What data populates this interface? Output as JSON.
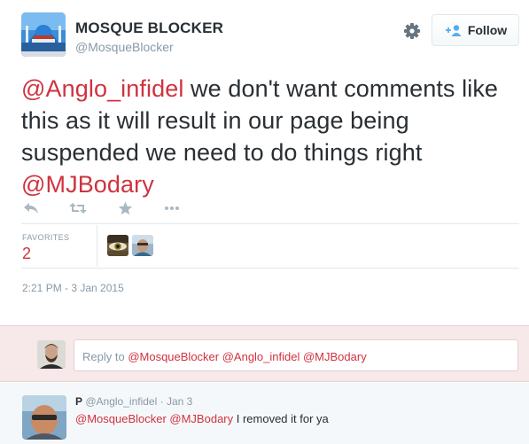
{
  "tweet": {
    "display_name": "MOSQUE BLOCKER",
    "screen_name": "@MosqueBlocker",
    "follow_label": "Follow",
    "text_parts": {
      "mention1": "@Anglo_infidel",
      "body": " we don't want comments like this as it will result in our page being suspended we need to do things right ",
      "mention2": "@MJBodary"
    },
    "actions": [
      "reply-icon",
      "retweet-icon",
      "favorite-icon",
      "more-icon"
    ],
    "stats": {
      "favorites_label": "FAVORITES",
      "favorites_count": "2"
    },
    "timestamp": "2:21 PM - 3 Jan 2015"
  },
  "reply_box": {
    "prefix": "Reply to ",
    "mentions": "@MosqueBlocker @Anglo_infidel @MJBodary"
  },
  "reply_tweet": {
    "name": "P",
    "handle": "@Anglo_infidel",
    "separator": " · ",
    "date": "Jan 3",
    "mentions": "@MosqueBlocker @MJBodary",
    "text": " I removed it for ya"
  },
  "colors": {
    "accent": "#d0323f",
    "muted": "#8899a6",
    "text": "#292f33",
    "reply_bg": "#f7e8e9"
  }
}
